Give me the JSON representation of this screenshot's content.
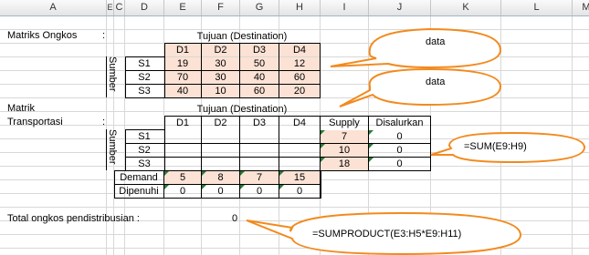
{
  "columns": [
    "A",
    "E",
    "C",
    "D",
    "E",
    "F",
    "G",
    "H",
    "I",
    "J",
    "K",
    "L",
    "M"
  ],
  "cost": {
    "label": "Matriks Ongkos",
    "colon": ":",
    "header": "Tujuan (Destination)",
    "dest": [
      "D1",
      "D2",
      "D3",
      "D4"
    ],
    "side": "Sumber",
    "rows": [
      {
        "src": "S1",
        "v": [
          "19",
          "30",
          "50",
          "12"
        ]
      },
      {
        "src": "S2",
        "v": [
          "70",
          "30",
          "40",
          "60"
        ]
      },
      {
        "src": "S3",
        "v": [
          "40",
          "10",
          "60",
          "20"
        ]
      }
    ]
  },
  "transport": {
    "label1": "Matrik",
    "label2": "Transportasi",
    "colon": ":",
    "header": "Tujuan (Destination)",
    "dest": [
      "D1",
      "D2",
      "D3",
      "D4"
    ],
    "supply_h": "Supply",
    "disalurkan_h": "Disalurkan",
    "side": "Sumber",
    "rows": [
      {
        "src": "S1",
        "supply": "7",
        "dis": "0"
      },
      {
        "src": "S2",
        "supply": "10",
        "dis": "0"
      },
      {
        "src": "S3",
        "supply": "18",
        "dis": "0"
      }
    ],
    "demand_label": "Demand",
    "demand": [
      "5",
      "8",
      "7",
      "15"
    ],
    "dipenuhi_label": "Dipenuhi",
    "dipenuhi": [
      "0",
      "0",
      "0",
      "0"
    ]
  },
  "total": {
    "label": "Total ongkos pendistribusian :",
    "value": "0"
  },
  "callouts": {
    "c1": "data",
    "c2": "data",
    "c3": "=SUM(E9:H9)",
    "c4": "=SUMPRODUCT(E3:H5*E9:H11)"
  },
  "colors": {
    "callout_stroke": "#f28a1e",
    "peach": "#fbe2d5",
    "marker": "#2a7a3a"
  }
}
